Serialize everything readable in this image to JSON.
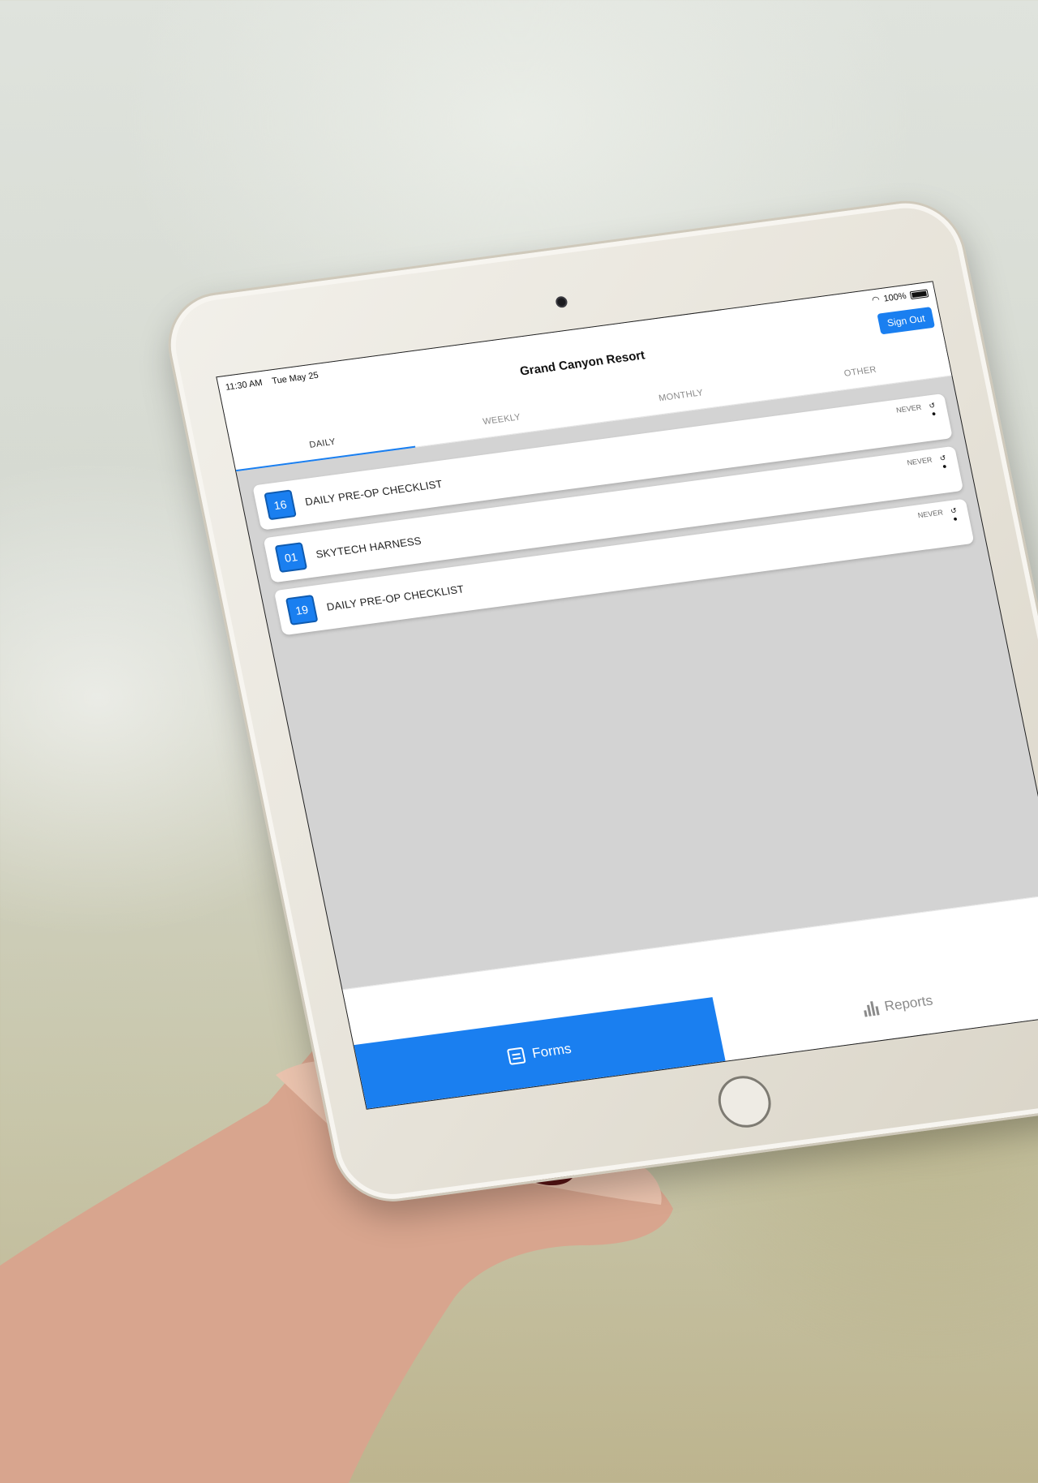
{
  "status_bar": {
    "time": "11:30 AM",
    "date": "Tue May 25",
    "battery": "100%",
    "wifi_icon": "wifi-icon",
    "battery_icon": "battery-icon"
  },
  "header": {
    "title": "Grand Canyon Resort",
    "sign_out_label": "Sign Out"
  },
  "tabs": [
    {
      "label": "DAILY",
      "active": true
    },
    {
      "label": "WEEKLY",
      "active": false
    },
    {
      "label": "MONTHLY",
      "active": false
    },
    {
      "label": "OTHER",
      "active": false
    }
  ],
  "forms": [
    {
      "number": "16",
      "name": "DAILY PRE-OP CHECKLIST",
      "status": "NEVER"
    },
    {
      "number": "01",
      "name": "SKYTECH HARNESS",
      "status": "NEVER"
    },
    {
      "number": "19",
      "name": "DAILY PRE-OP CHECKLIST",
      "status": "NEVER"
    }
  ],
  "bottom_nav": {
    "forms_label": "Forms",
    "reports_label": "Reports",
    "forms_icon": "forms-icon",
    "reports_icon": "bar-chart-icon"
  },
  "colors": {
    "accent": "#1a7ff0",
    "screen_background": "#d3d3d3"
  }
}
